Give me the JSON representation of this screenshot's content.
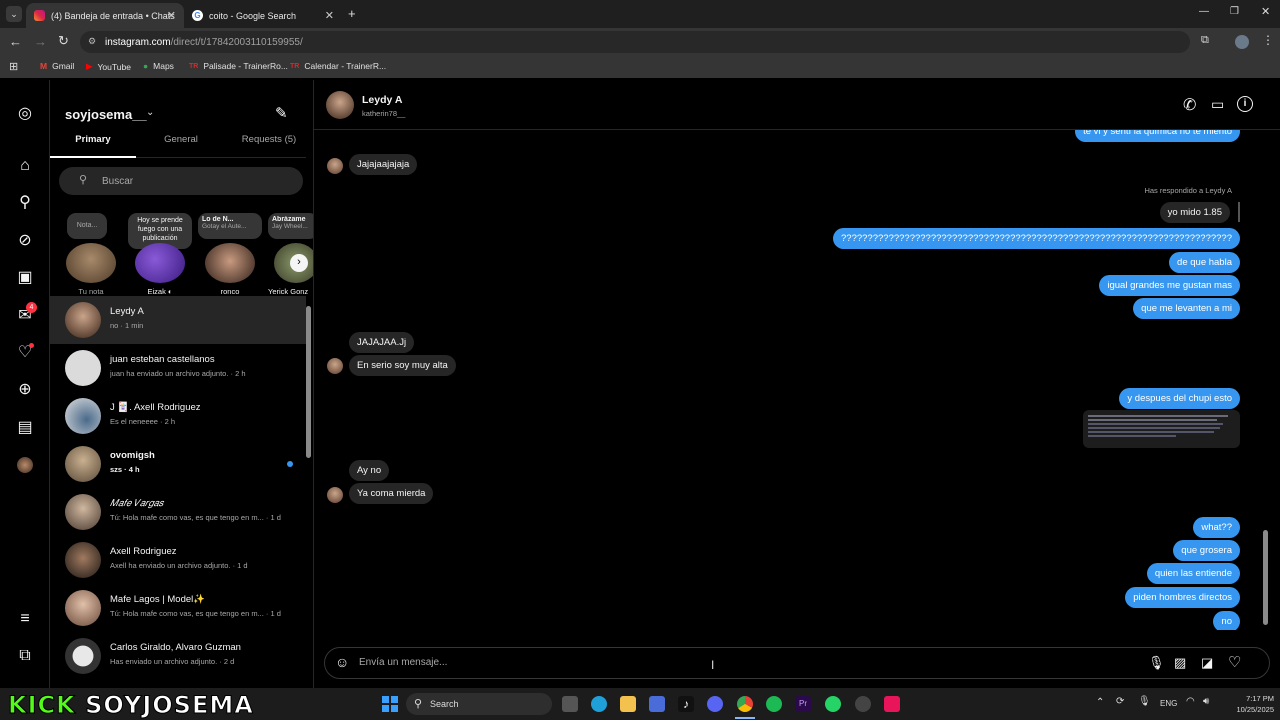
{
  "browser": {
    "tabs": [
      {
        "title": "(4) Bandeja de entrada • Chats",
        "active": true
      },
      {
        "title": "coito - Google Search",
        "active": false
      }
    ],
    "url_host": "instagram.com",
    "url_path": "/direct/t/17842003110159955/",
    "bookmarks": [
      "Gmail",
      "YouTube",
      "Maps",
      "Palisade - TrainerRo...",
      "Calendar - TrainerR..."
    ]
  },
  "inbox": {
    "username": "soyjosema__",
    "tabs": [
      "Primary",
      "General",
      "Requests (5)"
    ],
    "search_placeholder": "Buscar",
    "notes": [
      {
        "bubble": "Nota...",
        "name": "Tu nota"
      },
      {
        "bubble": "Hoy se prende fuego con una publicación",
        "name": "Eizak ◐"
      },
      {
        "bubble": "Lo de N...",
        "sub": "Gotay el Aute...",
        "name": "ronco"
      },
      {
        "bubble": "Abrázame",
        "sub": "Jay Wheel...",
        "name": "Yerick Gonz"
      }
    ],
    "conversations": [
      {
        "name": "Leydy A",
        "sub": "no · 1 min"
      },
      {
        "name": "juan esteban castellanos",
        "sub": "juan ha enviado un archivo adjunto. · 2 h"
      },
      {
        "name": "J 🃏. Axell Rodriguez",
        "sub": "Es el neneeee · 2 h"
      },
      {
        "name": "ovomigsh",
        "sub": "szs · 4 h"
      },
      {
        "name": "𝑀𝑎𝑓𝑒 𝑉𝑎𝑟𝑔𝑎𝑠",
        "sub": "Tú: Hola mafe como vas, es que tengo en m... · 1 d"
      },
      {
        "name": "Axell Rodriguez",
        "sub": "Axell ha enviado un archivo adjunto. · 1 d"
      },
      {
        "name": "Mafe Lagos | Model✨",
        "sub": "Tú: Hola mafe como vas, es que tengo en m... · 1 d"
      },
      {
        "name": "Carlos Giraldo, Alvaro Guzman",
        "sub": "Has enviado un archivo adjunto. · 2 d"
      }
    ],
    "unread_badge": "4"
  },
  "chat": {
    "contact_name": "Leydy A",
    "contact_handle": "katherin78__",
    "top_partial": "te vi y sentí la química no te miento",
    "reply_note": "Has respondido a Leydy A",
    "messages_in": [
      "Jajajaajajaja",
      "JAJAJAA.Jj",
      "En serio soy muy alta",
      "Ay no",
      "Ya coma mierda"
    ],
    "messages_out": [
      "yo mido 1.85",
      "??????????????????????????????????????????????????????????????????????????",
      "de que habla",
      "igual grandes me gustan mas",
      "que me levanten a mi",
      "y despues del chupi esto",
      "what??",
      "que grosera",
      "quien las entiende",
      "piden hombres directos",
      "no"
    ],
    "composer_placeholder": "Envía un mensaje..."
  },
  "overlay": {
    "brand": "KICK",
    "channel": "SOYJOSEMA"
  },
  "taskbar": {
    "search": "Search",
    "lang": "ENG",
    "time": "7:17 PM",
    "date": "10/25/2025"
  },
  "colors": {
    "accent": "#3797f0",
    "bubble_in": "#262626",
    "kick_green": "#53fc18"
  }
}
